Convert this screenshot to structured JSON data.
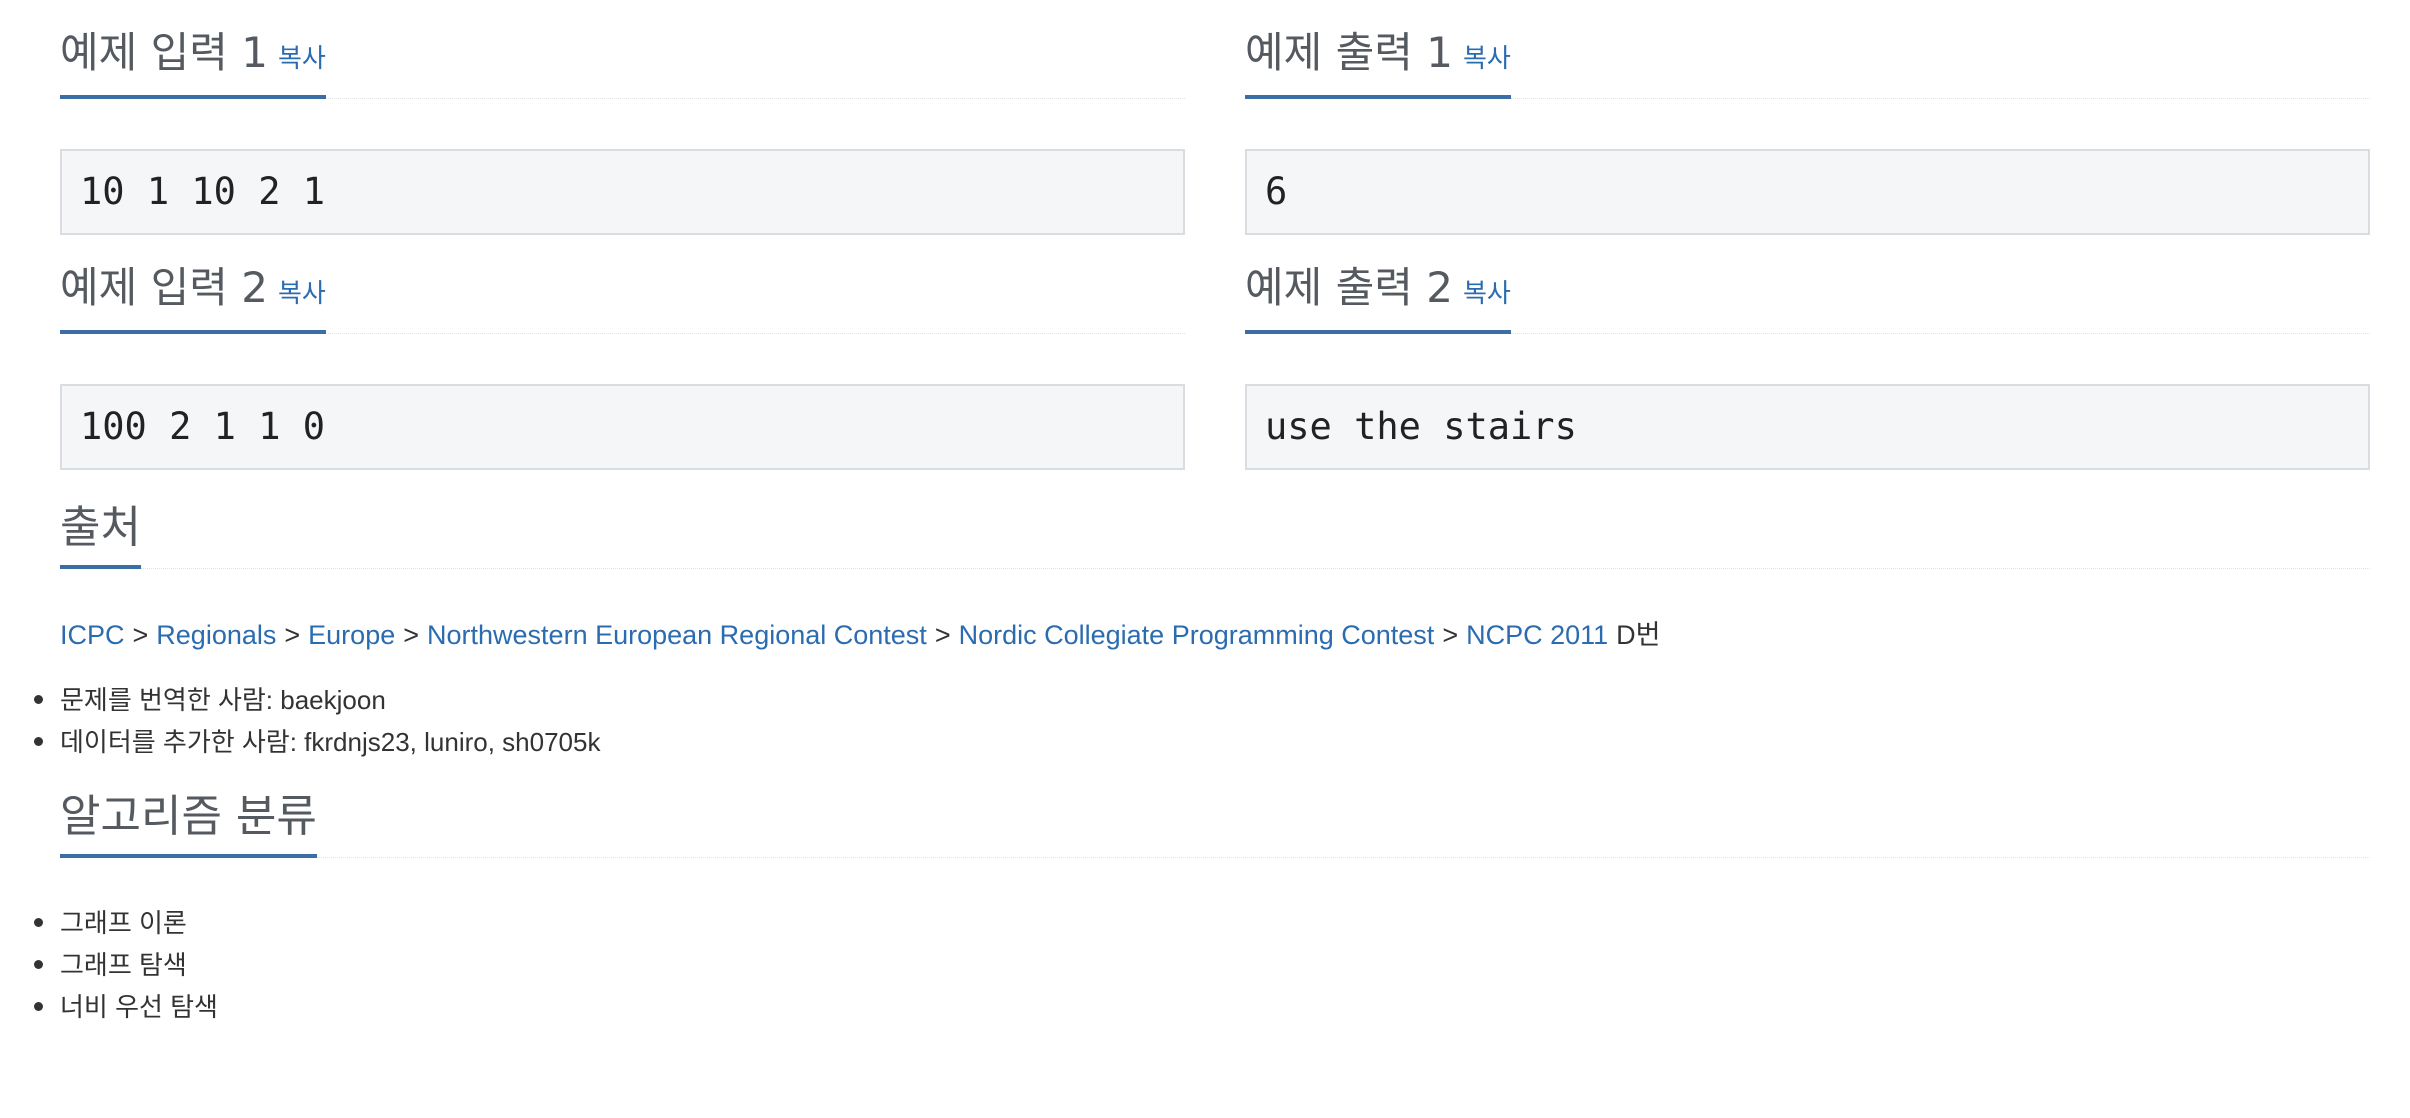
{
  "samples": [
    {
      "input": {
        "title": "예제 입력 1",
        "copy": "복사",
        "value": "10 1 10 2 1"
      },
      "output": {
        "title": "예제 출력 1",
        "copy": "복사",
        "value": "6"
      }
    },
    {
      "input": {
        "title": "예제 입력 2",
        "copy": "복사",
        "value": "100 2 1 1 0"
      },
      "output": {
        "title": "예제 출력 2",
        "copy": "복사",
        "value": "use the stairs"
      }
    }
  ],
  "source": {
    "title": "출처",
    "breadcrumb": [
      "ICPC",
      "Regionals",
      "Europe",
      "Northwestern European Regional Contest",
      "Nordic Collegiate Programming Contest",
      "NCPC 2011"
    ],
    "separator": ">",
    "suffix": "D번",
    "credits": [
      "문제를 번역한 사람: baekjoon",
      "데이터를 추가한 사람: fkrdnjs23, luniro, sh0705k"
    ]
  },
  "algorithms": {
    "title": "알고리즘 분류",
    "items": [
      "그래프 이론",
      "그래프 탐색",
      "너비 우선 탐색"
    ]
  },
  "colors": {
    "link": "#2b6cb0",
    "heading_underline": "#3a6ea5",
    "sample_bg": "#f5f6f8"
  }
}
